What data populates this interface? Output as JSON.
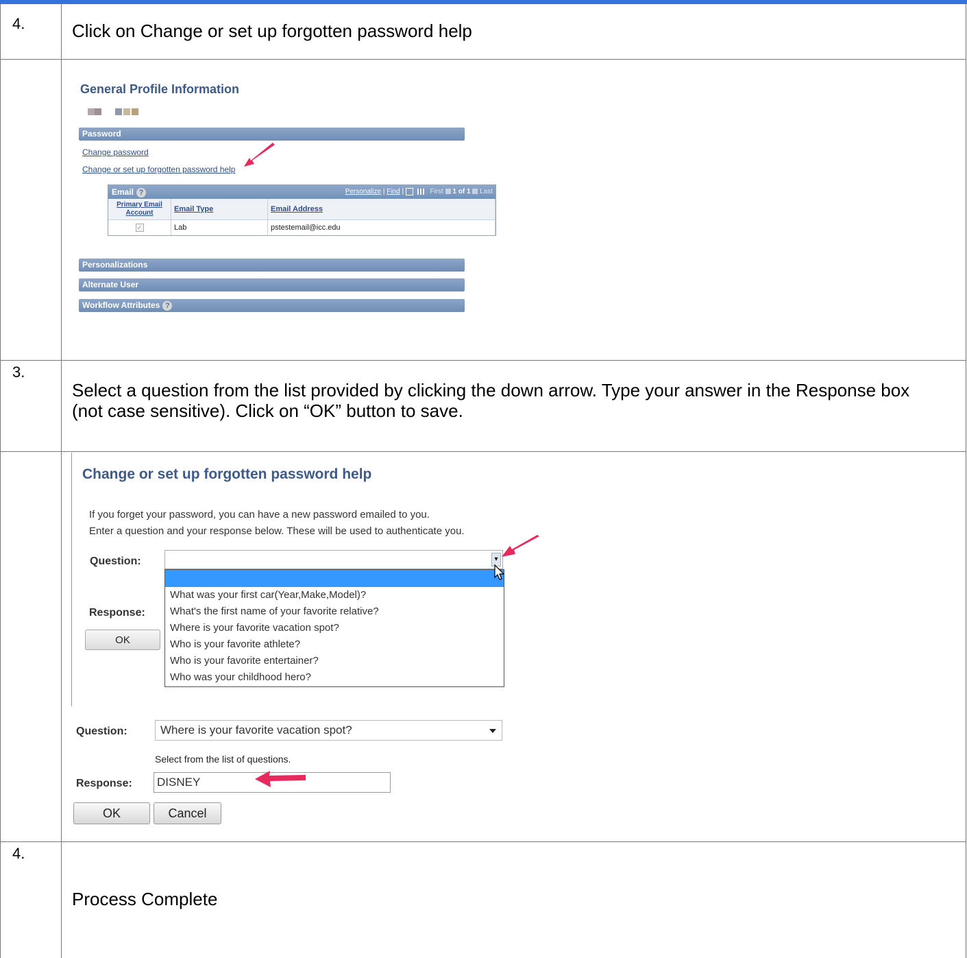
{
  "steps": [
    {
      "number": "4.",
      "text": "Click on Change or set up forgotten password help"
    },
    {
      "number": "3.",
      "text": "Select a question from the list provided by clicking the down arrow.  Type your answer in the Response box (not case sensitive).  Click on “OK” button to save."
    },
    {
      "number": "4.",
      "text": "Process Complete"
    }
  ],
  "general_profile": {
    "title": "General Profile Information",
    "password_section": "Password",
    "change_password_link": "Change password",
    "forgotten_help_link": "Change or set up forgotten password help",
    "email_grid": {
      "title": "Email",
      "help_icon": "?",
      "nav_personalize": "Personalize",
      "nav_sep1": " | ",
      "nav_find": "Find",
      "nav_sep2": " | ",
      "nav_first": "First",
      "nav_count": "1 of 1",
      "nav_last": "Last",
      "columns": [
        "Primary Email Account",
        "Email Type",
        "Email Address"
      ],
      "row": {
        "primary_checked": "✓",
        "type": "Lab",
        "address": "pstestemail@icc.edu"
      }
    },
    "sections": [
      "Personalizations",
      "Alternate User",
      "Workflow Attributes"
    ],
    "workflow_help_icon": "?"
  },
  "forgot_help_dropdown": {
    "title": "Change or set up forgotten password help",
    "intro_line1": "If you forget your password, you can have a new password emailed to you.",
    "intro_line2": "Enter a question and your response below. These will be used to authenticate you.",
    "question_label": "Question:",
    "response_label": "Response:",
    "ok_label": "OK",
    "arrow_glyph": "▾",
    "options": [
      "What was your first car(Year,Make,Model)?",
      "What's the first name of your favorite relative?",
      "Where is your favorite vacation spot?",
      "Who is your favorite athlete?",
      "Who is your favorite entertainer?",
      "Who was your childhood hero?"
    ]
  },
  "forgot_help_filled": {
    "question_label": "Question:",
    "selected_question": "Where is your favorite vacation spot?",
    "hint": "Select from the list of questions.",
    "response_label": "Response:",
    "response_value": "DISNEY",
    "ok_label": "OK",
    "cancel_label": "Cancel"
  },
  "colors": {
    "top_bar": "#3b6fe0",
    "section_bar": "#7e98bf",
    "title_blue": "#3e5a86",
    "annotation_arrow": "#e8295c",
    "dropdown_highlight": "#3399ff"
  }
}
